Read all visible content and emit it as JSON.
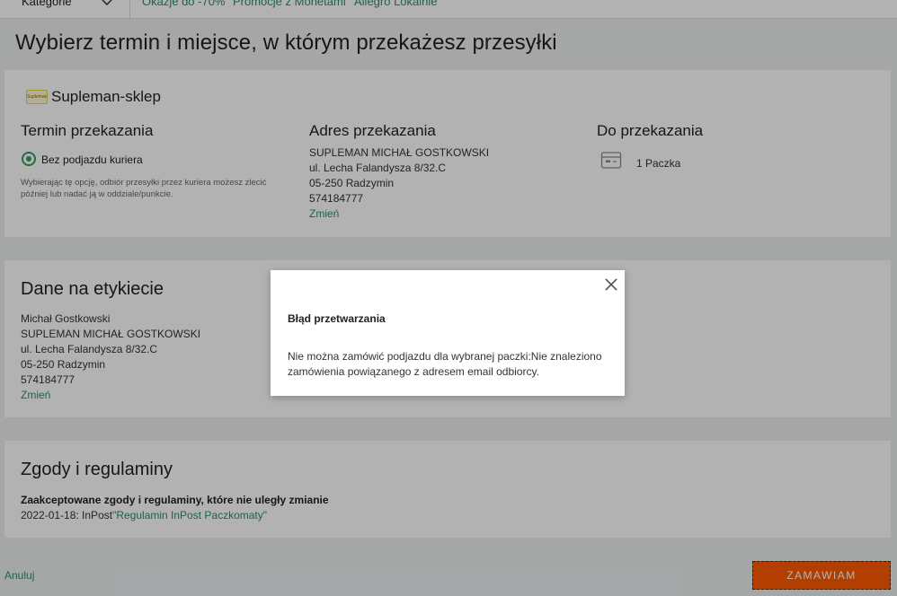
{
  "topnav": {
    "category_label": "Kategorie",
    "links": [
      "Okazje do -70%",
      "Promocje z Monetami",
      "Allegro Lokalnie"
    ]
  },
  "page_title": "Wybierz termin i miejsce, w którym przekażesz przesyłki",
  "seller": {
    "logo_text": "Supleman",
    "name": "Supleman-sklep"
  },
  "handover_time": {
    "heading": "Termin przekazania",
    "option_label": "Bez podjazdu kuriera",
    "hint": "Wybierając tę opcję, odbiór przesyłki przez kuriera możesz zlecić później lub nadać ją w oddziale/punkcie."
  },
  "handover_address": {
    "heading": "Adres przekazania",
    "lines": [
      "SUPLEMAN MICHAŁ GOSTKOWSKI",
      "ul. Lecha Falandysza 8/32.C",
      "05-250 Radzymin",
      "574184777"
    ],
    "change_link": "Zmień"
  },
  "to_handover": {
    "heading": "Do przekazania",
    "package_label": "1 Paczka",
    "icon": "package-icon"
  },
  "label_data": {
    "heading": "Dane na etykiecie",
    "lines": [
      "Michał Gostkowski",
      "SUPLEMAN MICHAŁ GOSTKOWSKI",
      "ul. Lecha Falandysza 8/32.C",
      "05-250 Radzymin",
      "574184777"
    ],
    "change_link": "Zmień"
  },
  "consents": {
    "heading": "Zgody i regulaminy",
    "subheading": "Zaakceptowane zgody i regulaminy, które nie uległy zmianie",
    "entry_prefix": "2022-01-18: InPost",
    "entry_link": "\"Regulamin InPost Paczkomaty\""
  },
  "footer": {
    "cancel_link": "Anuluj",
    "order_button": "ZAMAWIAM"
  },
  "modal": {
    "title": "Błąd przetwarzania",
    "message": "Nie można zamówić podjazdu dla wybranej paczki:Nie znaleziono zamówienia powiązanego z adresem email odbiorcy.",
    "close_icon": "close-icon"
  },
  "colors": {
    "accent_green": "#2e8b6b",
    "radio_green": "#2e9e5b",
    "order_orange": "#ff5a00",
    "background": "#eceff0"
  }
}
